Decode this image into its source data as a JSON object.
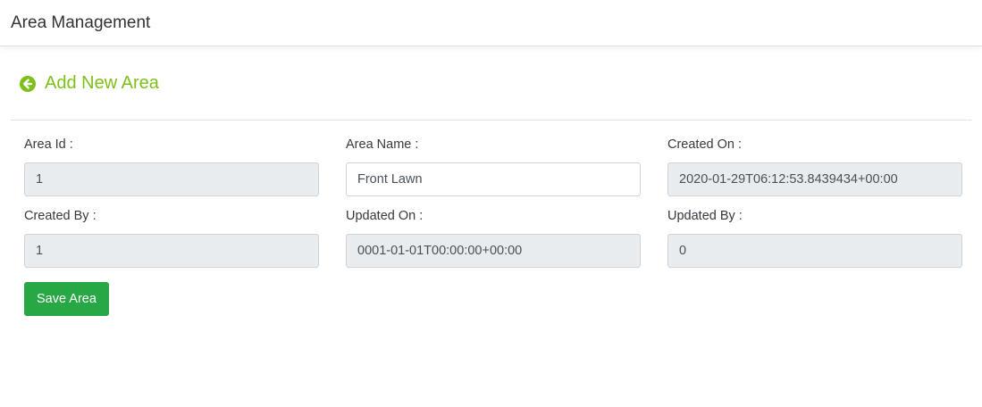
{
  "header": {
    "title": "Area Management"
  },
  "section": {
    "title": "Add New Area",
    "back_icon": "arrow-circle-left-icon",
    "accent_color": "#7dc01a"
  },
  "form": {
    "area_id": {
      "label": "Area Id :",
      "value": "1"
    },
    "area_name": {
      "label": "Area Name :",
      "value": "Front Lawn"
    },
    "created_on": {
      "label": "Created On :",
      "value": "2020-01-29T06:12:53.8439434+00:00"
    },
    "created_by": {
      "label": "Created By :",
      "value": "1"
    },
    "updated_on": {
      "label": "Updated On :",
      "value": "0001-01-01T00:00:00+00:00"
    },
    "updated_by": {
      "label": "Updated By :",
      "value": "0"
    }
  },
  "actions": {
    "save_label": "Save Area",
    "save_color": "#28a745"
  }
}
